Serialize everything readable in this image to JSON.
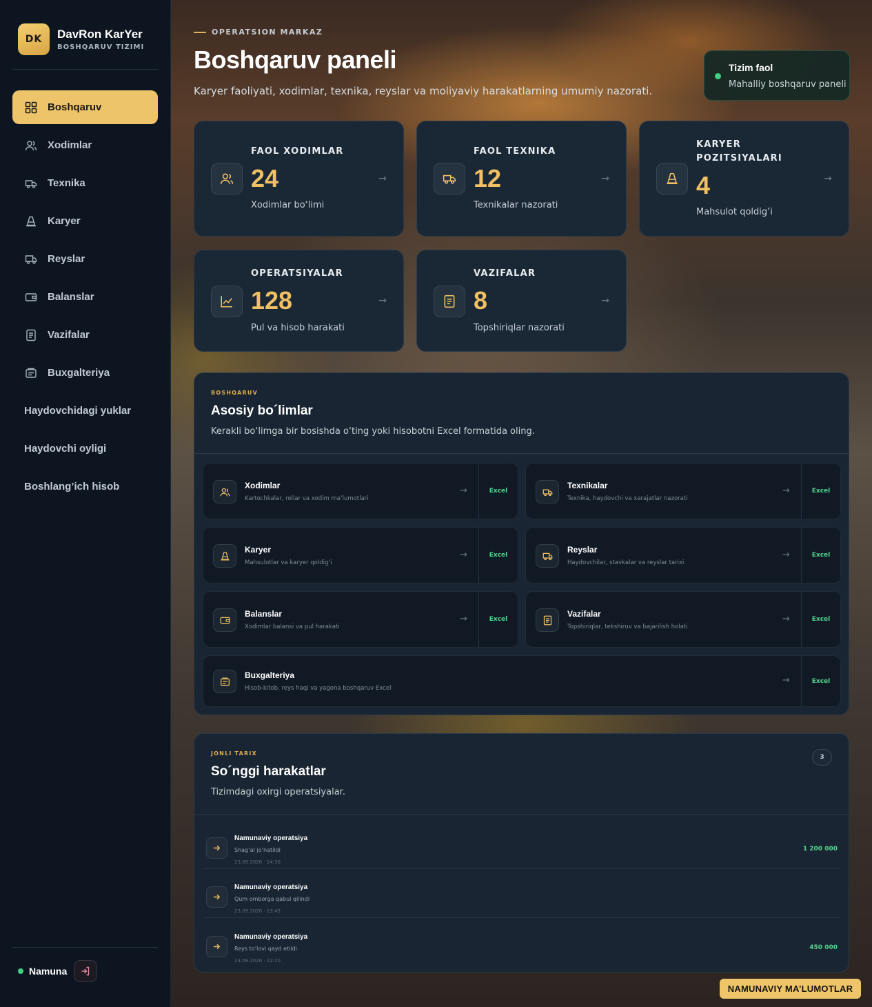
{
  "brand": {
    "logo": "DK",
    "name": "DavRon KarYer",
    "subtitle": "BOSHQARUV TIZIMI"
  },
  "sidebar": {
    "items": [
      {
        "label": "Boshqaruv",
        "icon": "grid-icon",
        "active": true
      },
      {
        "label": "Xodimlar",
        "icon": "users-icon"
      },
      {
        "label": "Texnika",
        "icon": "truck-icon"
      },
      {
        "label": "Karyer",
        "icon": "cone-icon"
      },
      {
        "label": "Reyslar",
        "icon": "truck-icon"
      },
      {
        "label": "Balanslar",
        "icon": "wallet-icon"
      },
      {
        "label": "Vazifalar",
        "icon": "document-icon"
      },
      {
        "label": "Buxgalteriya",
        "icon": "ledger-icon"
      },
      {
        "label": "Haydovchidagi yuklar"
      },
      {
        "label": "Haydovchi oyligi"
      },
      {
        "label": "Boshlang’ich hisob"
      }
    ],
    "user": {
      "name": "Namuna",
      "status_color": "#3fd07f"
    }
  },
  "header": {
    "eyebrow": "OPERATSION MARKAZ",
    "title": "Boshqaruv paneli",
    "subtitle": "Karyer faoliyati, xodimlar, texnika, reyslar va moliyaviy harakatlarning umumiy nazorati."
  },
  "status": {
    "title": "Tizim faol",
    "subtitle": "Mahalliy boshqaruv paneli"
  },
  "kpis": [
    {
      "label_lines": [
        "FAOL XODIMLAR"
      ],
      "value": "24",
      "subtitle": "Xodimlar bo‘limi",
      "icon": "users-icon",
      "arrow": "→"
    },
    {
      "label_lines": [
        "FAOL TEXNIKA"
      ],
      "value": "12",
      "subtitle": "Texnikalar nazorati",
      "icon": "truck-icon",
      "arrow": "→"
    },
    {
      "label_lines": [
        "KARYER",
        "POZITSIYALARI"
      ],
      "value": "4",
      "subtitle": "Mahsulot qoldig’i",
      "icon": "cone-icon",
      "arrow": "→"
    },
    {
      "label_lines": [
        "OPERATSIYALAR"
      ],
      "value": "128",
      "subtitle": "Pul va hisob harakati",
      "icon": "chart-icon",
      "arrow": "→"
    },
    {
      "label_lines": [
        "VAZIFALAR"
      ],
      "value": "8",
      "subtitle": "Topshiriqlar nazorati",
      "icon": "document-icon",
      "arrow": "→"
    }
  ],
  "sections": {
    "eyebrow": "BOSHQARUV",
    "title": "Asosiy bo´limlar",
    "description": "Kerakli bo‘limga bir bosishda o‘ting yoki hisobotni Excel formatida oling.",
    "excel_label": "Excel",
    "arrow": "→",
    "items": [
      {
        "name": "Xodimlar",
        "desc": "Kartochkalar, rollar va xodim ma’lumotlari",
        "icon": "users-icon"
      },
      {
        "name": "Texnikalar",
        "desc": "Texnika, haydovchi va xarajatlar nazorati",
        "icon": "truck-icon"
      },
      {
        "name": "Karyer",
        "desc": "Mahsulotlar va karyer qoldig‘i",
        "icon": "cone-icon"
      },
      {
        "name": "Reyslar",
        "desc": "Haydovchilar, stavkalar va reyslar tarixi",
        "icon": "truck-icon"
      },
      {
        "name": "Balanslar",
        "desc": "Xodimlar balansi va pul harakati",
        "icon": "wallet-icon"
      },
      {
        "name": "Vazifalar",
        "desc": "Topshiriqlar, tekshiruv va bajarilish holati",
        "icon": "document-icon"
      },
      {
        "name": "Buxgalteriya",
        "desc": "Hisob-kitob, reys haqi va yagona boshqaruv Excel",
        "icon": "ledger-icon"
      }
    ]
  },
  "activity": {
    "eyebrow": "JONLI TARIX",
    "title": "So´nggi harakatlar",
    "description": "Tizimdagi oxirgi operatsiyalar.",
    "count": "3",
    "items": [
      {
        "title": "Namunaviy operatsiya",
        "desc": "Shag‘al jo‘natildi",
        "time": "23.09.2026 · 14:30",
        "amount": "1 200 000"
      },
      {
        "title": "Namunaviy operatsiya",
        "desc": "Qum omborga qabul qilindi",
        "time": "23.09.2026 · 13:45",
        "amount": ""
      },
      {
        "title": "Namunaviy operatsiya",
        "desc": "Reys to‘lovi qayd etildi",
        "time": "23.09.2026 · 12:20",
        "amount": "450 000"
      }
    ]
  },
  "demo_button": "NAMUNAVIY MA’LUMOTLAR",
  "colors": {
    "accent": "#eec46b",
    "positive": "#54d38d",
    "panel": "#192532",
    "sidebar": "#0d1620"
  }
}
